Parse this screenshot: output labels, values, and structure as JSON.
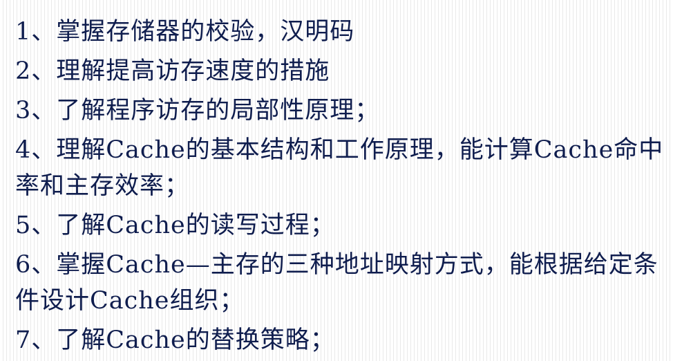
{
  "objectives": [
    "1、掌握存储器的校验，汉明码",
    "2、理解提高访存速度的措施",
    "3、了解程序访存的局部性原理；",
    "4、理解Cache的基本结构和工作原理，能计算Cache命中率和主存效率；",
    "5、了解Cache的读写过程；",
    "6、掌握Cache—主存的三种地址映射方式，能根据给定条件设计Cache组织；",
    "7、了解Cache的替换策略；"
  ],
  "colors": {
    "text": "#0f1d4e",
    "background": "#ffffff",
    "stripe": "#e9e9e9"
  }
}
